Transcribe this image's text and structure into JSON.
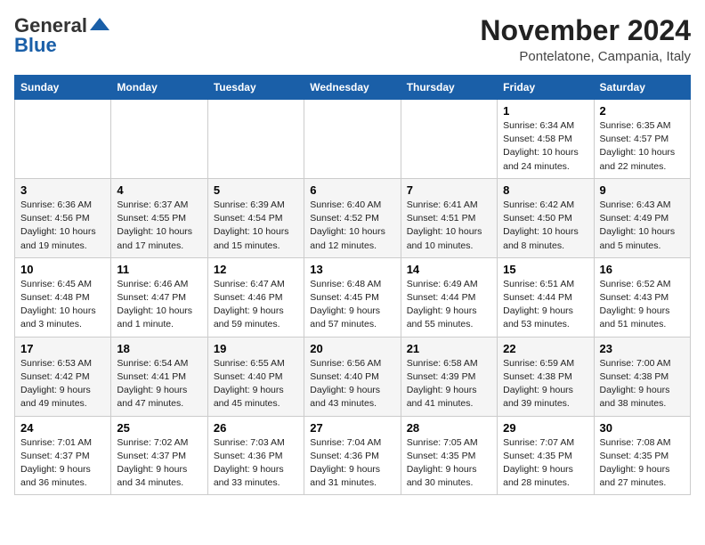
{
  "header": {
    "logo_general": "General",
    "logo_blue": "Blue",
    "month_title": "November 2024",
    "location": "Pontelatone, Campania, Italy"
  },
  "calendar": {
    "days_of_week": [
      "Sunday",
      "Monday",
      "Tuesday",
      "Wednesday",
      "Thursday",
      "Friday",
      "Saturday"
    ],
    "weeks": [
      [
        {
          "day": "",
          "info": ""
        },
        {
          "day": "",
          "info": ""
        },
        {
          "day": "",
          "info": ""
        },
        {
          "day": "",
          "info": ""
        },
        {
          "day": "",
          "info": ""
        },
        {
          "day": "1",
          "info": "Sunrise: 6:34 AM\nSunset: 4:58 PM\nDaylight: 10 hours and 24 minutes."
        },
        {
          "day": "2",
          "info": "Sunrise: 6:35 AM\nSunset: 4:57 PM\nDaylight: 10 hours and 22 minutes."
        }
      ],
      [
        {
          "day": "3",
          "info": "Sunrise: 6:36 AM\nSunset: 4:56 PM\nDaylight: 10 hours and 19 minutes."
        },
        {
          "day": "4",
          "info": "Sunrise: 6:37 AM\nSunset: 4:55 PM\nDaylight: 10 hours and 17 minutes."
        },
        {
          "day": "5",
          "info": "Sunrise: 6:39 AM\nSunset: 4:54 PM\nDaylight: 10 hours and 15 minutes."
        },
        {
          "day": "6",
          "info": "Sunrise: 6:40 AM\nSunset: 4:52 PM\nDaylight: 10 hours and 12 minutes."
        },
        {
          "day": "7",
          "info": "Sunrise: 6:41 AM\nSunset: 4:51 PM\nDaylight: 10 hours and 10 minutes."
        },
        {
          "day": "8",
          "info": "Sunrise: 6:42 AM\nSunset: 4:50 PM\nDaylight: 10 hours and 8 minutes."
        },
        {
          "day": "9",
          "info": "Sunrise: 6:43 AM\nSunset: 4:49 PM\nDaylight: 10 hours and 5 minutes."
        }
      ],
      [
        {
          "day": "10",
          "info": "Sunrise: 6:45 AM\nSunset: 4:48 PM\nDaylight: 10 hours and 3 minutes."
        },
        {
          "day": "11",
          "info": "Sunrise: 6:46 AM\nSunset: 4:47 PM\nDaylight: 10 hours and 1 minute."
        },
        {
          "day": "12",
          "info": "Sunrise: 6:47 AM\nSunset: 4:46 PM\nDaylight: 9 hours and 59 minutes."
        },
        {
          "day": "13",
          "info": "Sunrise: 6:48 AM\nSunset: 4:45 PM\nDaylight: 9 hours and 57 minutes."
        },
        {
          "day": "14",
          "info": "Sunrise: 6:49 AM\nSunset: 4:44 PM\nDaylight: 9 hours and 55 minutes."
        },
        {
          "day": "15",
          "info": "Sunrise: 6:51 AM\nSunset: 4:44 PM\nDaylight: 9 hours and 53 minutes."
        },
        {
          "day": "16",
          "info": "Sunrise: 6:52 AM\nSunset: 4:43 PM\nDaylight: 9 hours and 51 minutes."
        }
      ],
      [
        {
          "day": "17",
          "info": "Sunrise: 6:53 AM\nSunset: 4:42 PM\nDaylight: 9 hours and 49 minutes."
        },
        {
          "day": "18",
          "info": "Sunrise: 6:54 AM\nSunset: 4:41 PM\nDaylight: 9 hours and 47 minutes."
        },
        {
          "day": "19",
          "info": "Sunrise: 6:55 AM\nSunset: 4:40 PM\nDaylight: 9 hours and 45 minutes."
        },
        {
          "day": "20",
          "info": "Sunrise: 6:56 AM\nSunset: 4:40 PM\nDaylight: 9 hours and 43 minutes."
        },
        {
          "day": "21",
          "info": "Sunrise: 6:58 AM\nSunset: 4:39 PM\nDaylight: 9 hours and 41 minutes."
        },
        {
          "day": "22",
          "info": "Sunrise: 6:59 AM\nSunset: 4:38 PM\nDaylight: 9 hours and 39 minutes."
        },
        {
          "day": "23",
          "info": "Sunrise: 7:00 AM\nSunset: 4:38 PM\nDaylight: 9 hours and 38 minutes."
        }
      ],
      [
        {
          "day": "24",
          "info": "Sunrise: 7:01 AM\nSunset: 4:37 PM\nDaylight: 9 hours and 36 minutes."
        },
        {
          "day": "25",
          "info": "Sunrise: 7:02 AM\nSunset: 4:37 PM\nDaylight: 9 hours and 34 minutes."
        },
        {
          "day": "26",
          "info": "Sunrise: 7:03 AM\nSunset: 4:36 PM\nDaylight: 9 hours and 33 minutes."
        },
        {
          "day": "27",
          "info": "Sunrise: 7:04 AM\nSunset: 4:36 PM\nDaylight: 9 hours and 31 minutes."
        },
        {
          "day": "28",
          "info": "Sunrise: 7:05 AM\nSunset: 4:35 PM\nDaylight: 9 hours and 30 minutes."
        },
        {
          "day": "29",
          "info": "Sunrise: 7:07 AM\nSunset: 4:35 PM\nDaylight: 9 hours and 28 minutes."
        },
        {
          "day": "30",
          "info": "Sunrise: 7:08 AM\nSunset: 4:35 PM\nDaylight: 9 hours and 27 minutes."
        }
      ]
    ]
  }
}
